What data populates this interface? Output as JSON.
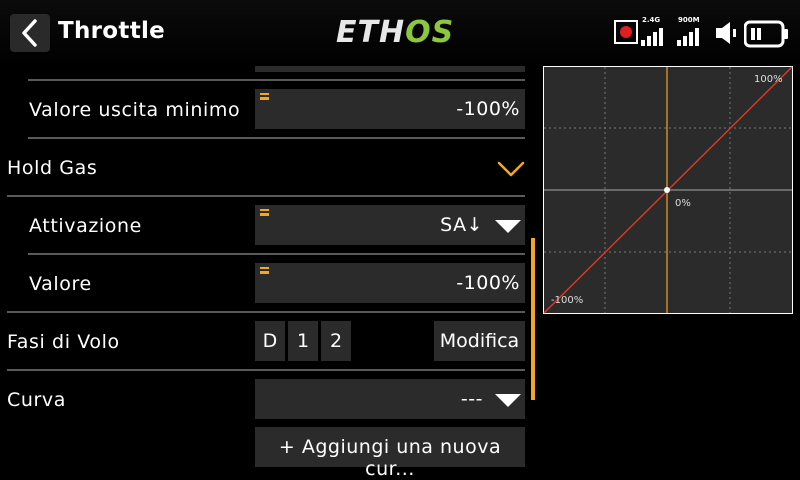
{
  "header": {
    "title": "Throttle",
    "logo_a": "ETH",
    "logo_b": "OS",
    "rx1_label": "2.4G",
    "rx2_label": "900M",
    "icons": [
      "back-icon",
      "record-icon",
      "signal-icon",
      "signal-icon",
      "volume-icon",
      "battery-icon"
    ]
  },
  "rows": {
    "min_output": {
      "label": "Valore uscita minimo",
      "value": "-100%"
    },
    "hold": {
      "label": "Hold Gas"
    },
    "activation": {
      "label": "Attivazione",
      "value": "SA↓"
    },
    "value": {
      "label": "Valore",
      "value": "-100%"
    },
    "flight_modes": {
      "label": "Fasi di Volo",
      "modes": [
        "D",
        "1",
        "2"
      ],
      "edit_label": "Modifica"
    },
    "curve": {
      "label": "Curva",
      "value": "---"
    },
    "add_curve": {
      "label": "+ Aggiungi una nuova cur..."
    }
  },
  "graph": {
    "top_right_label": "100%",
    "center_label": "0%",
    "bottom_left_label": "-100%"
  },
  "colors": {
    "accent": "#f5a623",
    "curve": "#e03a1e",
    "brand_green": "#8dc63f",
    "field_bg": "#2b2b2b"
  }
}
